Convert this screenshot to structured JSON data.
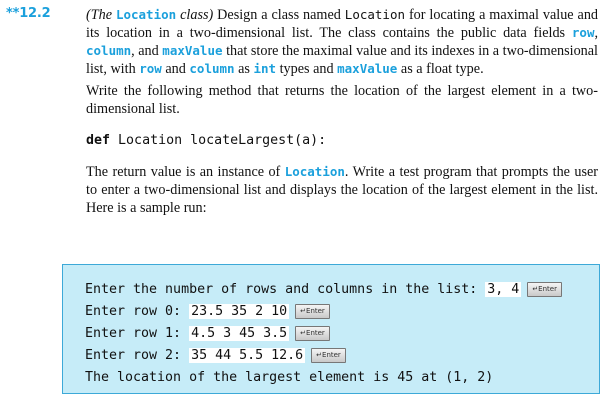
{
  "exercise": {
    "number": "**12.2",
    "title": "(The Location class)",
    "paragraph1": {
      "t1": "Design a class named",
      "location_class": "Location",
      "t2": "for locating a maximal value and its location in a two-dimensional list. The class contains the public data fields",
      "row": "row",
      "column": "column",
      "t3": ", and",
      "maxValue": "maxValue",
      "t4": "that store the maximal value and its indexes in a two-dimensional list, with",
      "t5": "and",
      "int": "int",
      "t6": "as",
      "t7": "types and",
      "t8": "as a float type."
    },
    "paragraph2": "Write the following method that returns the location of the largest element in a two-dimensional list.",
    "signature": {
      "keyword": "def",
      "rest": "Location locateLargest(a):"
    },
    "paragraph3": {
      "t1": "The return value is an instance of",
      "location_class": "Location",
      "t2": ". Write a test program that prompts the user to enter a two-dimensional list and displays the location of the largest element in the list. Here is a sample run:"
    }
  },
  "sample_run": {
    "enter_key_label": "↵Enter",
    "lines": [
      {
        "prompt": "Enter the number of rows and columns in the list: ",
        "input": "3, 4"
      },
      {
        "prompt": "Enter row 0: ",
        "input": "23.5 35 2 10"
      },
      {
        "prompt": "Enter row 1: ",
        "input": "4.5 3 45 3.5"
      },
      {
        "prompt": "Enter row 2: ",
        "input": "35 44 5.5 12.6"
      },
      {
        "prompt": "The location of the largest element is 45 at (1, 2)",
        "input": ""
      }
    ]
  },
  "colors": {
    "accent": "#1ba0dc",
    "run_background": "#c6ecf8",
    "run_border": "#3da9d8"
  }
}
